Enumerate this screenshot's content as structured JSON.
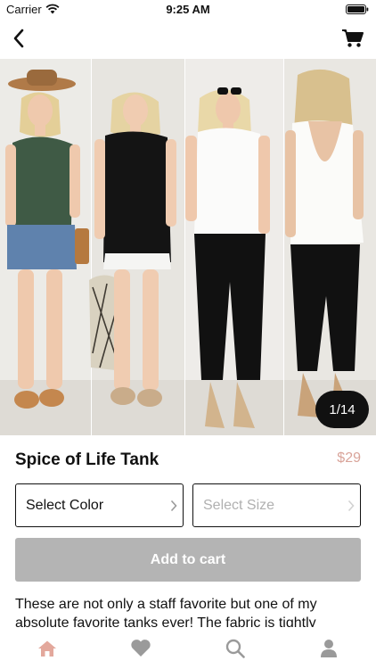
{
  "status_bar": {
    "carrier": "Carrier",
    "time": "9:25 AM"
  },
  "nav": {
    "back_icon": "chevron-left-icon",
    "cart_icon": "cart-icon"
  },
  "gallery": {
    "counter": "1/14",
    "image_count": 14,
    "current_index": 1
  },
  "product": {
    "title": "Spice of Life Tank",
    "price": "$29",
    "price_color": "#d9a49a",
    "select_color_label": "Select Color",
    "select_size_label": "Select Size",
    "add_to_cart_label": "Add to cart",
    "description": "These are not only a staff favorite but one of my absolute favorite tanks ever! The fabric is tightly"
  },
  "tabs": [
    {
      "name": "home",
      "icon": "home-icon",
      "active": true,
      "color": "#e3a89c"
    },
    {
      "name": "favorites",
      "icon": "heart-icon",
      "active": false,
      "color": "#9a9a9a"
    },
    {
      "name": "search",
      "icon": "search-icon",
      "active": false,
      "color": "#9a9a9a"
    },
    {
      "name": "account",
      "icon": "person-icon",
      "active": false,
      "color": "#9a9a9a"
    }
  ]
}
